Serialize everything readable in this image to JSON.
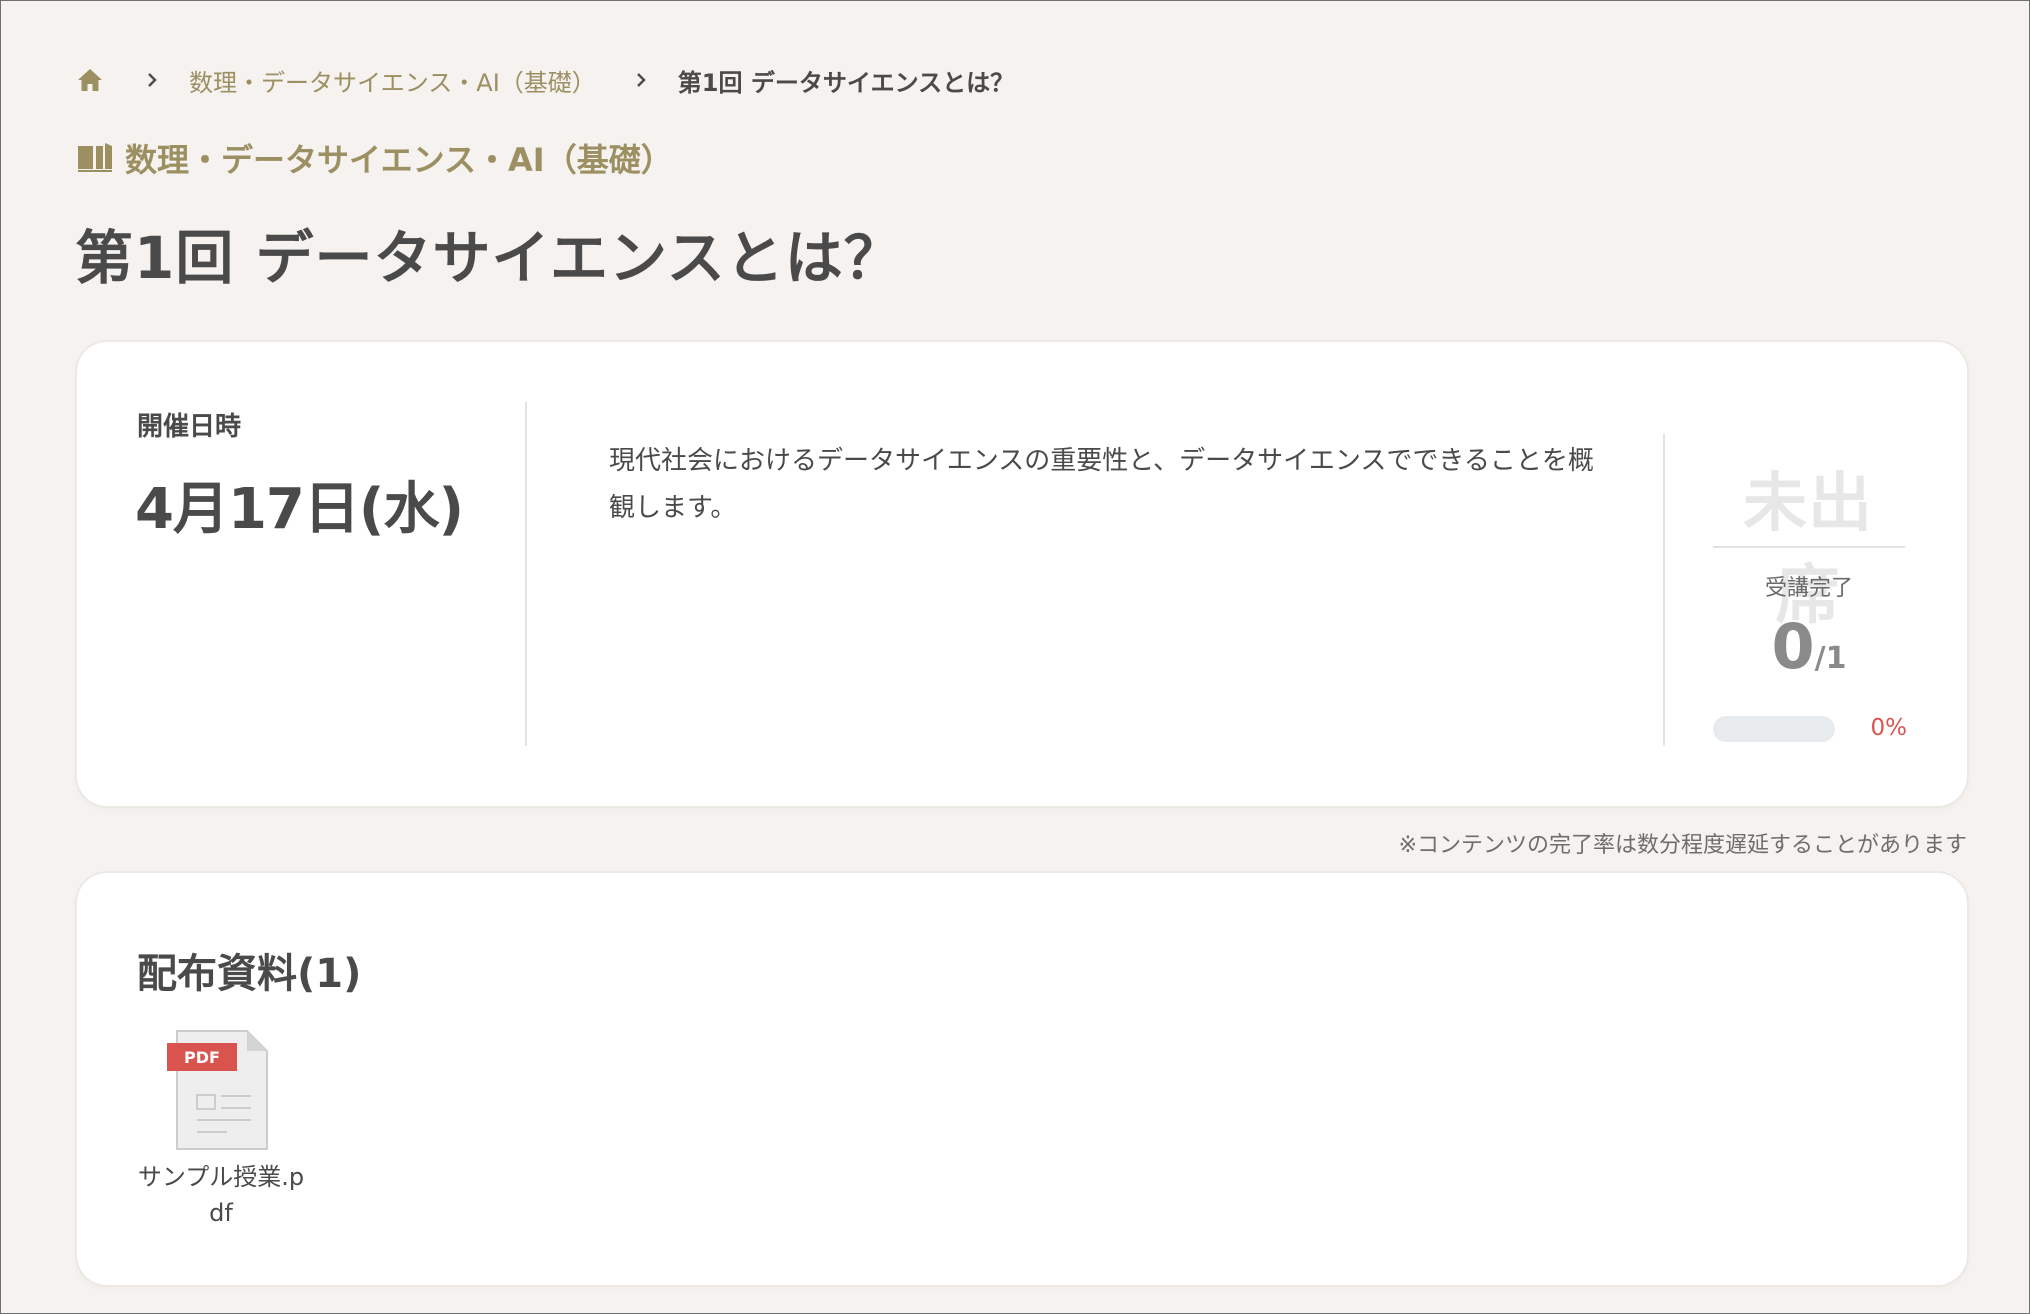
{
  "breadcrumb": {
    "home_icon": "home-icon",
    "separator_icon": "chevron-right-icon",
    "course_link": "数理・データサイエンス・AI（基礎）",
    "current": "第1回 データサイエンスとは？"
  },
  "course": {
    "icon": "book-open-icon",
    "title": "数理・データサイエンス・AI（基礎）"
  },
  "page_title": "第1回 データサイエンスとは？",
  "session": {
    "date_label": "開催日時",
    "date_value": "4月17日(水)",
    "description": "現代社会におけるデータサイエンスの重要性と、データサイエンスでできることを概観します。",
    "attendance_status": "未出席",
    "completion_label": "受講完了",
    "completed_count": "0",
    "total_count": "/1",
    "progress_fraction": 0,
    "progress_percent": "0%"
  },
  "note": "※コンテンツの完了率は数分程度遅延することがあります",
  "materials": {
    "title": "配布資料(1)",
    "files": [
      {
        "name": "サンプル授業.pdf",
        "badge": "PDF",
        "icon": "pdf-file-icon"
      }
    ]
  },
  "colors": {
    "background": "#f5f2ef",
    "accent_olive": "#9c8f62",
    "text": "#4a4a4a",
    "danger_red": "#d9534f",
    "pdf_badge": "#d9534f",
    "attendance_muted": "#e7e7e7"
  }
}
